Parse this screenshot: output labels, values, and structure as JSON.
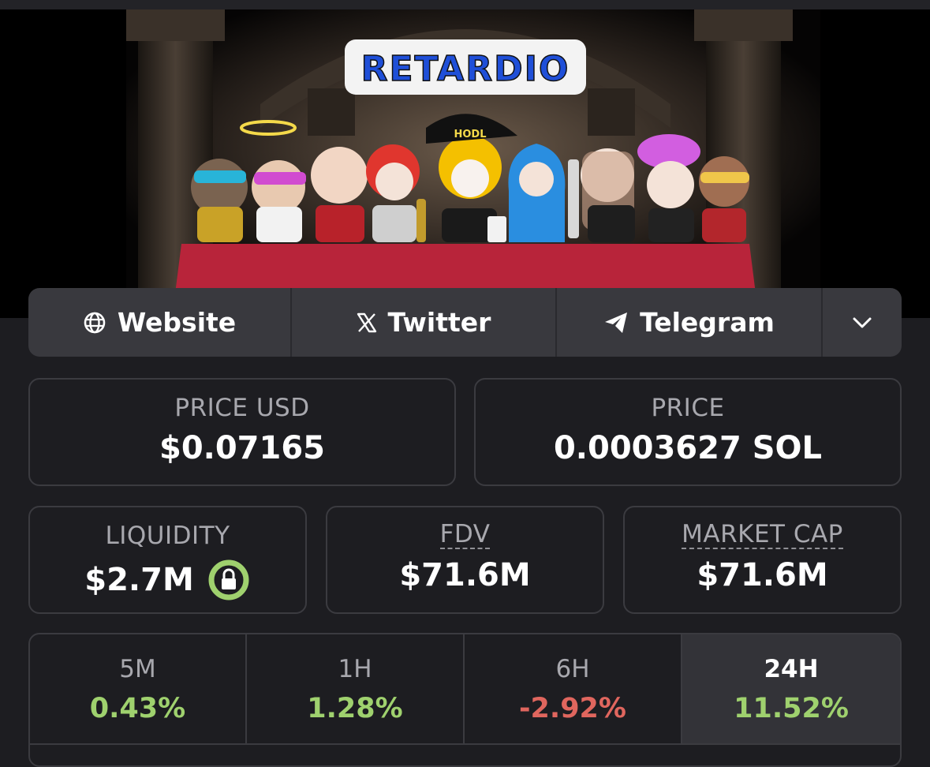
{
  "banner": {
    "logo_text": "RETARDIO",
    "cap_text": "HODL"
  },
  "links": {
    "website": "Website",
    "twitter": "Twitter",
    "telegram": "Telegram"
  },
  "stats": {
    "price_usd": {
      "label": "PRICE USD",
      "value": "$0.07165"
    },
    "price_native": {
      "label": "PRICE",
      "value": "0.0003627 SOL"
    },
    "liquidity": {
      "label": "LIQUIDITY",
      "value": "$2.7M"
    },
    "fdv": {
      "label": "FDV",
      "value": "$71.6M"
    },
    "market_cap": {
      "label": "MARKET CAP",
      "value": "$71.6M"
    }
  },
  "changes": [
    {
      "period": "5M",
      "value": "0.43%",
      "trend": "up"
    },
    {
      "period": "1H",
      "value": "1.28%",
      "trend": "up"
    },
    {
      "period": "6H",
      "value": "-2.92%",
      "trend": "down"
    },
    {
      "period": "24H",
      "value": "11.52%",
      "trend": "up",
      "active": true
    }
  ],
  "colors": {
    "up": "#9fd16e",
    "down": "#e0665e",
    "lock_ring": "#9fd16e"
  },
  "icons": [
    "globe-icon",
    "x-logo-icon",
    "paper-plane-icon",
    "chevron-down-icon",
    "lock-icon"
  ]
}
